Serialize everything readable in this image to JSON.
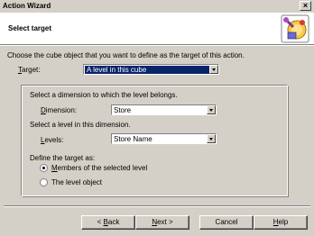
{
  "window": {
    "title": "Action Wizard"
  },
  "header": {
    "title": "Select target"
  },
  "instruction": "Choose the cube object that you want to define as the target of this action.",
  "target": {
    "label": "Target:",
    "value": "A level in this cube"
  },
  "group": {
    "dimension_instruction": "Select a dimension to which the level belongs.",
    "dimension_label": "Dimension:",
    "dimension_value": "Store",
    "level_instruction": "Select a level in this dimension.",
    "levels_label": "Levels:",
    "levels_value": "Store Name",
    "define_label": "Define the target as:",
    "radio_members": "Members of the selected level",
    "radio_level_object": "The level object",
    "selected_option": "members"
  },
  "buttons": {
    "back": "< Back",
    "next": "Next >",
    "cancel": "Cancel",
    "help": "Help"
  },
  "icons": {
    "close": "close-icon",
    "wizard": "wizard-icon",
    "dropdown": "chevron-down-icon"
  },
  "colors": {
    "selection": "#0a246a",
    "face": "#d4d0c8",
    "header_bg": "#ffffff"
  }
}
